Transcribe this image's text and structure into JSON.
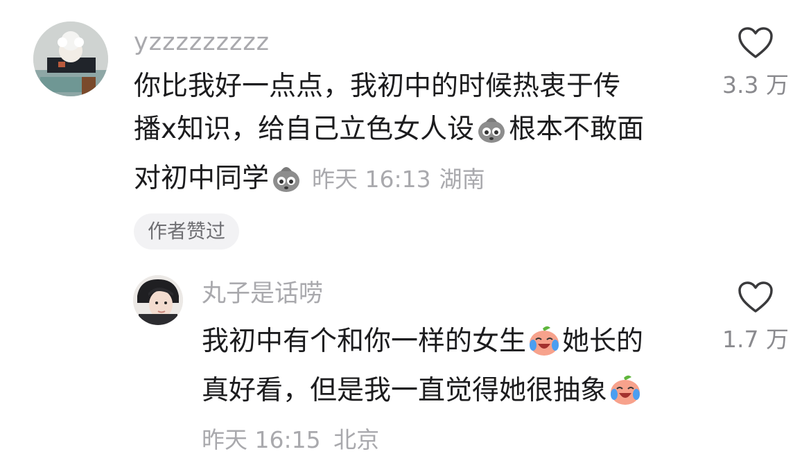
{
  "comments": [
    {
      "username": "yzzzzzzzzz",
      "text_line1": "你比我好一点点，我初中的时候热衷于传",
      "text_line2a": "播x知识，给自己立色女人设",
      "text_line2b": "根本不敢面",
      "text_line3": "对初中同学",
      "time": "昨天 16:13",
      "location": "湖南",
      "like_count": "3.3 万",
      "author_liked_badge": "作者赞过",
      "emoji": "pouch-face-emoji"
    },
    {
      "username": "丸子是话唠",
      "text_line1a": "我初中有个和你一样的女生",
      "text_line1b": "她长的",
      "text_line2": "真好看，但是我一直觉得她很抽象",
      "time": "昨天 16:15",
      "location": "北京",
      "like_count": "1.7 万",
      "emoji": "laughing-peach-emoji"
    }
  ],
  "icons": {
    "like": "heart-outline-icon"
  },
  "colors": {
    "username": "#a9a9ad",
    "text": "#1c1c1e",
    "badge_bg": "#f2f2f4"
  }
}
